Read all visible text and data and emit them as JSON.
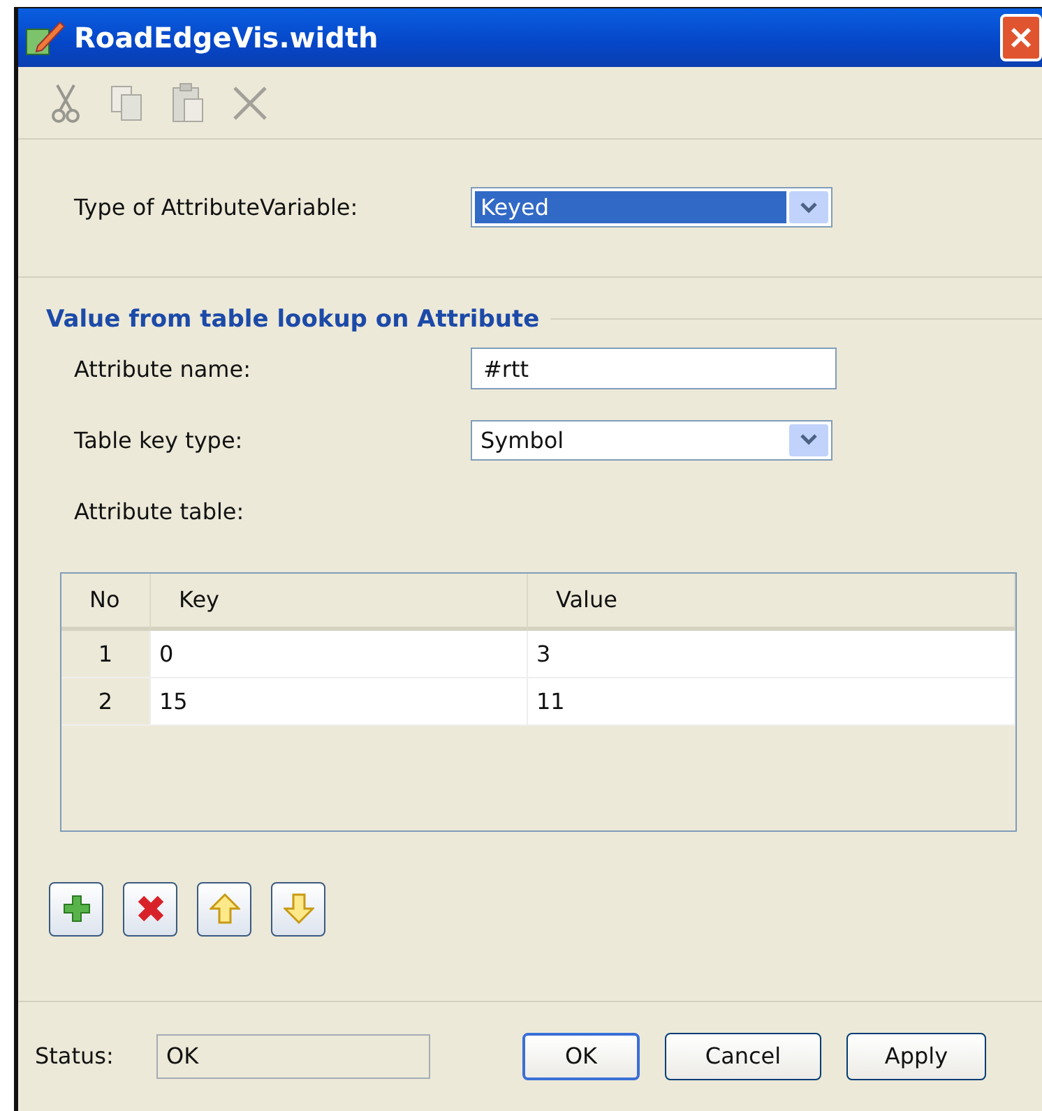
{
  "window": {
    "title": "RoadEdgeVis.width"
  },
  "toolbar": [
    {
      "kind": "cut",
      "disabled": true
    },
    {
      "kind": "copy",
      "disabled": true
    },
    {
      "kind": "paste",
      "disabled": true
    },
    {
      "kind": "delete",
      "disabled": true
    }
  ],
  "type_row": {
    "label": "Type of AttributeVariable:",
    "value": "Keyed",
    "focused": true
  },
  "section": {
    "title": "Value from table lookup on Attribute",
    "attribute_name": {
      "label": "Attribute name:",
      "value": "#rtt"
    },
    "key_type": {
      "label": "Table key type:",
      "value": "Symbol"
    },
    "table_label": "Attribute table:",
    "table": {
      "columns": [
        "No",
        "Key",
        "Value"
      ],
      "rows": [
        [
          "1",
          "0",
          "3"
        ],
        [
          "2",
          "15",
          "11"
        ]
      ]
    },
    "actions": [
      {
        "kind": "add"
      },
      {
        "kind": "remove"
      },
      {
        "kind": "up"
      },
      {
        "kind": "down"
      }
    ]
  },
  "status": {
    "label": "Status:",
    "value": "OK"
  },
  "buttons": [
    {
      "label": "OK",
      "default": true
    },
    {
      "label": "Cancel",
      "default": false
    },
    {
      "label": "Apply",
      "default": false
    }
  ]
}
